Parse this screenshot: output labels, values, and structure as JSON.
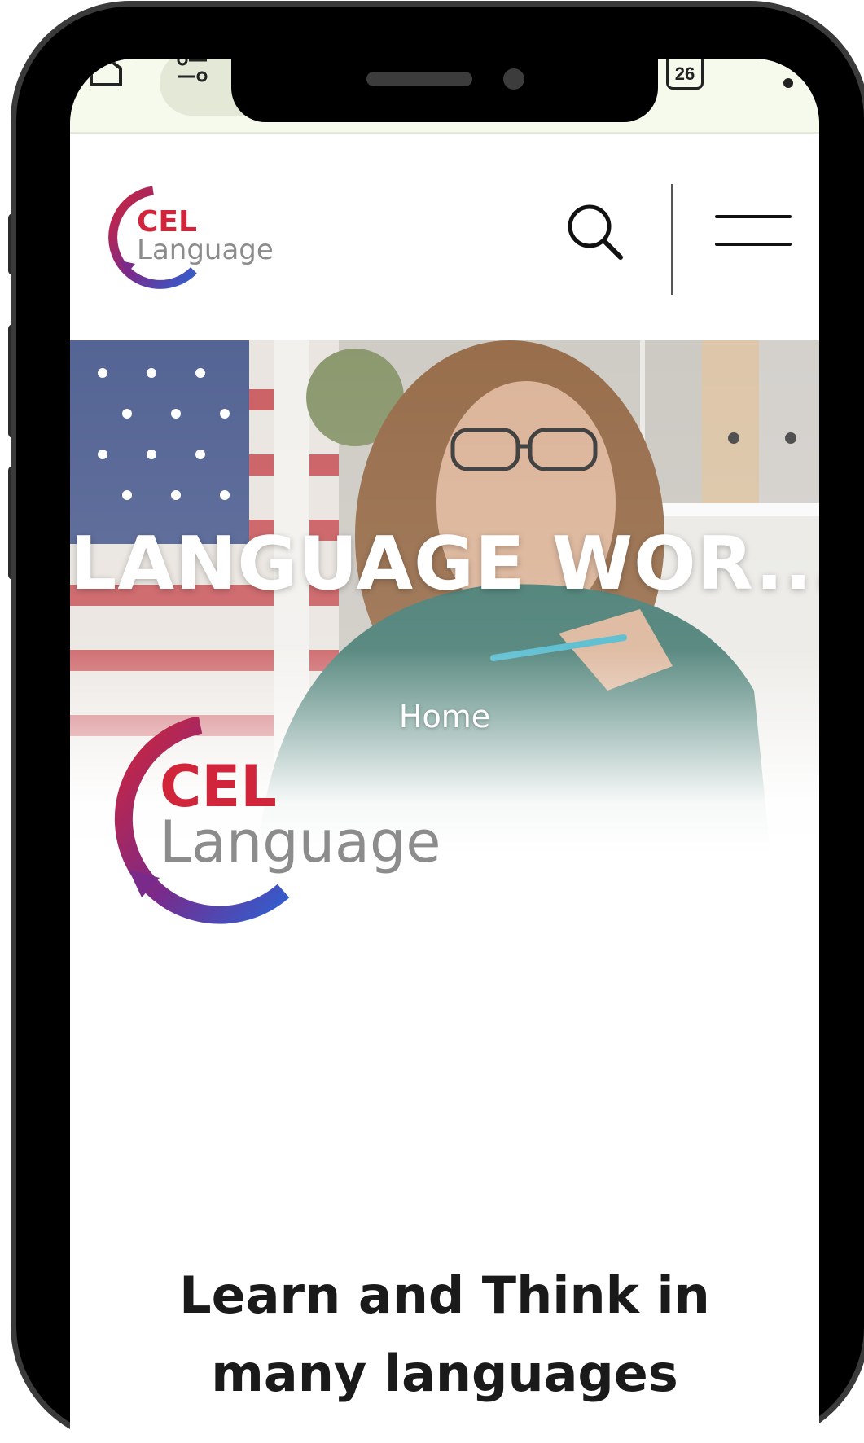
{
  "browser": {
    "home_icon": "home-icon",
    "settings_icon": "sliders-icon",
    "tab_count": "26",
    "more_icon": "more-vertical-icon"
  },
  "header": {
    "logo_line1": "CEL",
    "logo_line2": "Language",
    "search_icon": "search-icon",
    "menu_icon": "hamburger-menu-icon"
  },
  "hero": {
    "title": "LANGUAGE WOR...",
    "breadcrumb_home": "Home"
  },
  "main": {
    "logo_line1": "CEL",
    "logo_line2": "Language",
    "tagline": "Learn and Think in many languages"
  },
  "colors": {
    "brand_red": "#d0253a",
    "brand_blue": "#2f5fd0",
    "brand_purple": "#7a2a8a",
    "logo_gray": "#8c8c8c",
    "browser_bar": "#f6faed"
  }
}
